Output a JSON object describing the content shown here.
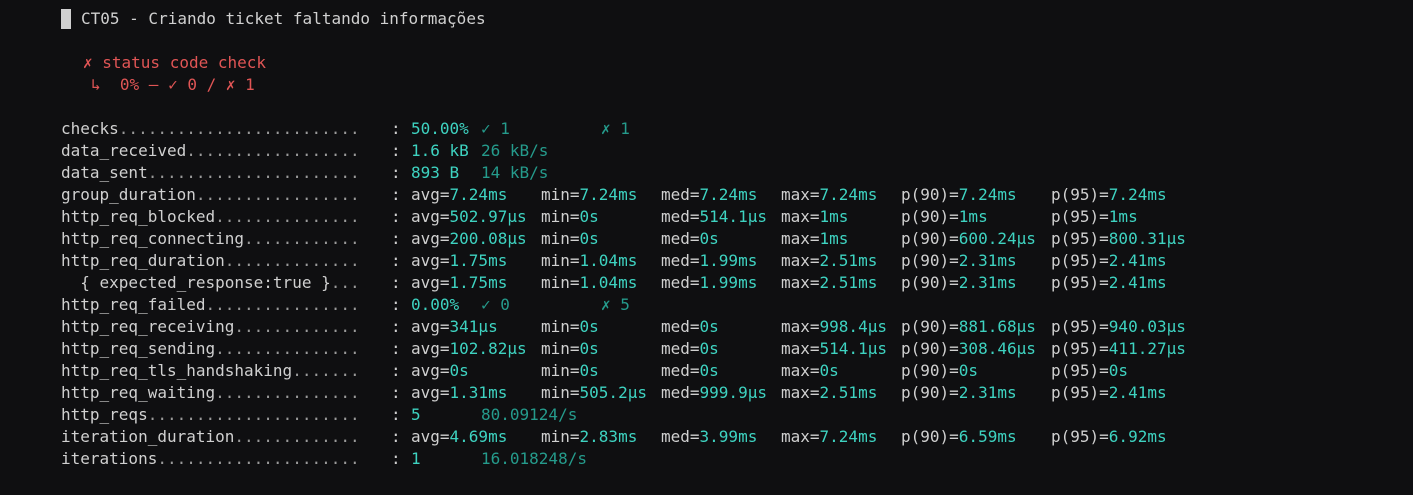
{
  "title": "CT05 - Criando ticket faltando informações",
  "check": {
    "name": "✗ status code check",
    "result": "↳  0% — ✓ 0 / ✗ 1"
  },
  "metrics": [
    {
      "name": "checks",
      "dots": ".........................",
      "kind": "rate",
      "value": "50.00%",
      "pass": "✓ 1",
      "fail": "✗ 1"
    },
    {
      "name": "data_received",
      "dots": "..................",
      "kind": "bytes",
      "value": "1.6 kB",
      "rate": "26 kB/s"
    },
    {
      "name": "data_sent",
      "dots": "......................",
      "kind": "bytes",
      "value": "893 B ",
      "rate": "14 kB/s"
    },
    {
      "name": "group_duration",
      "dots": ".................",
      "kind": "trend",
      "avg": "7.24ms",
      "min": "7.24ms",
      "med": "7.24ms",
      "max": "7.24ms",
      "p90": "7.24ms",
      "p95": "7.24ms"
    },
    {
      "name": "http_req_blocked",
      "dots": "...............",
      "kind": "trend",
      "avg": "502.97µs",
      "min": "0s",
      "med": "514.1µs",
      "max": "1ms",
      "p90": "1ms",
      "p95": "1ms"
    },
    {
      "name": "http_req_connecting",
      "dots": "............",
      "kind": "trend",
      "avg": "200.08µs",
      "min": "0s",
      "med": "0s",
      "max": "1ms",
      "p90": "600.24µs",
      "p95": "800.31µs"
    },
    {
      "name": "http_req_duration",
      "dots": "..............",
      "kind": "trend",
      "avg": "1.75ms",
      "min": "1.04ms",
      "med": "1.99ms",
      "max": "2.51ms",
      "p90": "2.31ms",
      "p95": "2.41ms"
    },
    {
      "name": "  { expected_response:true }",
      "dots": "...",
      "kind": "trend",
      "avg": "1.75ms",
      "min": "1.04ms",
      "med": "1.99ms",
      "max": "2.51ms",
      "p90": "2.31ms",
      "p95": "2.41ms"
    },
    {
      "name": "http_req_failed",
      "dots": "................",
      "kind": "rate",
      "value": "0.00% ",
      "pass": "✓ 0",
      "fail": "✗ 5"
    },
    {
      "name": "http_req_receiving",
      "dots": ".............",
      "kind": "trend",
      "avg": "341µs",
      "min": "0s",
      "med": "0s",
      "max": "998.4µs",
      "p90": "881.68µs",
      "p95": "940.03µs"
    },
    {
      "name": "http_req_sending",
      "dots": "...............",
      "kind": "trend",
      "avg": "102.82µs",
      "min": "0s",
      "med": "0s",
      "max": "514.1µs",
      "p90": "308.46µs",
      "p95": "411.27µs"
    },
    {
      "name": "http_req_tls_handshaking",
      "dots": ".......",
      "kind": "trend",
      "avg": "0s",
      "min": "0s",
      "med": "0s",
      "max": "0s",
      "p90": "0s",
      "p95": "0s"
    },
    {
      "name": "http_req_waiting",
      "dots": "...............",
      "kind": "trend",
      "avg": "1.31ms",
      "min": "505.2µs",
      "med": "999.9µs",
      "max": "2.51ms",
      "p90": "2.31ms",
      "p95": "2.41ms"
    },
    {
      "name": "http_reqs",
      "dots": "......................",
      "kind": "count",
      "value": "5",
      "rate": "80.09124/s"
    },
    {
      "name": "iteration_duration",
      "dots": ".............",
      "kind": "trend",
      "avg": "4.69ms",
      "min": "2.83ms",
      "med": "3.99ms",
      "max": "7.24ms",
      "p90": "6.59ms",
      "p95": "6.92ms"
    },
    {
      "name": "iterations",
      "dots": ".....................",
      "kind": "count",
      "value": "1",
      "rate": "16.018248/s"
    }
  ]
}
